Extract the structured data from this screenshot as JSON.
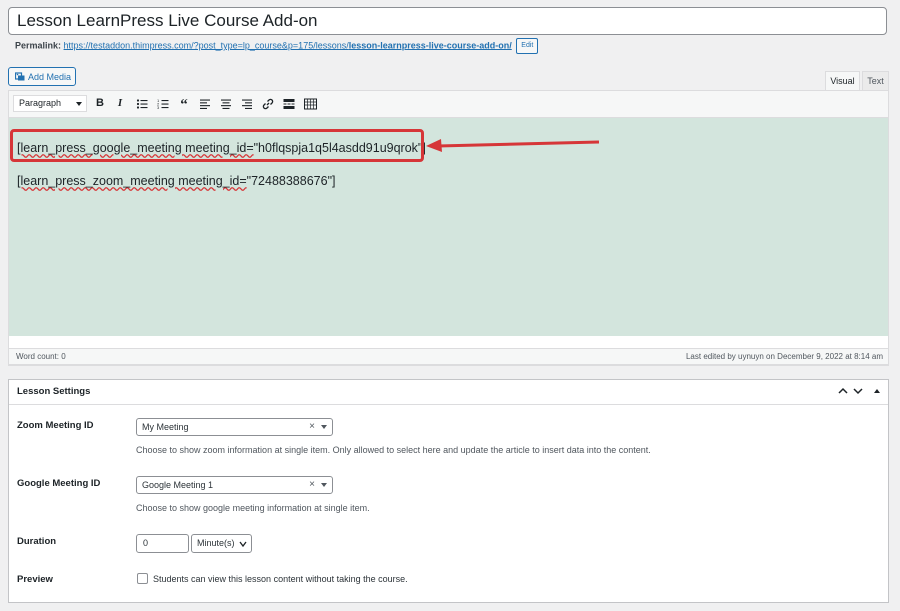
{
  "post": {
    "title": "Lesson LearnPress Live Course Add-on",
    "permalink_label": "Permalink:",
    "permalink_base": "https://testaddon.thimpress.com/?post_type=lp_course&p=175/lessons/",
    "permalink_slug": "lesson-learnpress-live-course-add-on/",
    "edit_label": "Edit"
  },
  "media": {
    "add_media_label": "Add Media",
    "icon": "media-icon"
  },
  "editor_tabs": [
    {
      "label": "Visual",
      "active": true
    },
    {
      "label": "Text",
      "active": false
    }
  ],
  "toolbar": {
    "format_select": "Paragraph",
    "buttons": [
      "bold",
      "italic",
      "bulleted-list",
      "numbered-list",
      "blockquote",
      "align-left",
      "align-center",
      "align-right",
      "link",
      "read-more",
      "toolbar-toggle"
    ]
  },
  "content": {
    "background": "#d3e5dd",
    "line1": {
      "part1": "[learn_press_google_meeting meeting_id=",
      "part2": "\"h0flqspja1q5l4asdd91u9qrok\"]"
    },
    "line2": {
      "part1": "[learn_press_zoom_meeting meeting_id=",
      "part2": "\"72488388676\"]"
    },
    "highlight_color": "#d63638"
  },
  "status": {
    "word_count": "Word count: 0",
    "last_edited": "Last edited by uynuyn on December 9, 2022 at 8:14 am"
  },
  "lesson_settings": {
    "title": "Lesson Settings",
    "zoom": {
      "label": "Zoom Meeting ID",
      "value": "My Meeting",
      "description": "Choose to show zoom information at single item. Only allowed to select here and update the article to insert data into the content."
    },
    "google": {
      "label": "Google Meeting ID",
      "value": "Google Meeting 1",
      "description": "Choose to show google meeting information at single item."
    },
    "duration": {
      "label": "Duration",
      "value": "0",
      "unit": "Minute(s)"
    },
    "preview": {
      "label": "Preview",
      "checkbox_label": "Students can view this lesson content without taking the course.",
      "checked": false
    }
  }
}
